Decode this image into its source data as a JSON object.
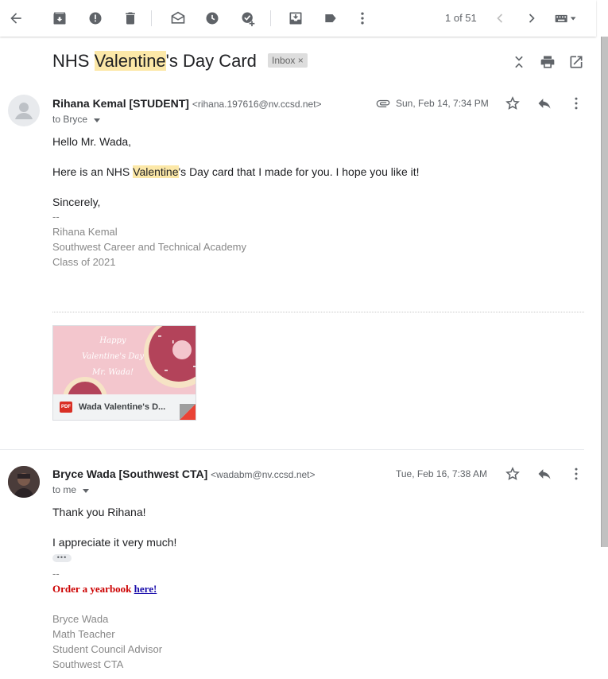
{
  "toolbar": {
    "pager_text": "1 of 51",
    "icons": [
      "back-arrow-icon",
      "archive-icon",
      "report-spam-icon",
      "delete-icon",
      "mark-unread-icon",
      "snooze-icon",
      "add-to-tasks-icon",
      "move-to-icon",
      "label-icon",
      "more-vert-icon",
      "older-chevron-icon",
      "newer-chevron-icon",
      "keyboard-icon"
    ]
  },
  "subject": {
    "before": "NHS ",
    "highlight": "Valentine",
    "after": "'s Day Card",
    "label_chip": "Inbox",
    "chip_close": "×"
  },
  "messages": [
    {
      "sender_name": "Rihana Kemal [STUDENT]",
      "sender_email": "<rihana.197616@nv.ccsd.net>",
      "to": "to Bryce",
      "date": "Sun, Feb 14, 7:34 PM",
      "greeting": "Hello Mr. Wada,",
      "body_before": "Here is an NHS ",
      "body_highlight": "Valentine",
      "body_after": "'s Day card that I made for you. I hope you like it!",
      "closing": "Sincerely,",
      "sig_dash": "--",
      "sig_lines": [
        "Rihana Kemal",
        "Southwest Career and Technical Academy",
        "Class of 2021"
      ],
      "attachment": {
        "file_type": "PDF",
        "name": "Wada Valentine's D...",
        "preview_text": [
          "Happy",
          "Valentine's Day",
          "Mr. Wada!"
        ]
      }
    },
    {
      "sender_name": "Bryce Wada [Southwest CTA]",
      "sender_email": "<wadabm@nv.ccsd.net>",
      "to": "to me",
      "date": "Tue, Feb 16, 7:38 AM",
      "line1": "Thank you Rihana!",
      "line2": "I appreciate it very much!",
      "trimmed": "•••",
      "sig_dash": "--",
      "yearbook_text": "Order a yearbook ",
      "yearbook_link": "here!",
      "sig_lines": [
        "Bryce Wada",
        "Math Teacher",
        "Student Council Advisor",
        "Southwest CTA"
      ]
    }
  ],
  "colors": {
    "highlight": "#fce8a8",
    "yearbook_red": "#cc0000",
    "link_blue": "#1a0dab"
  }
}
